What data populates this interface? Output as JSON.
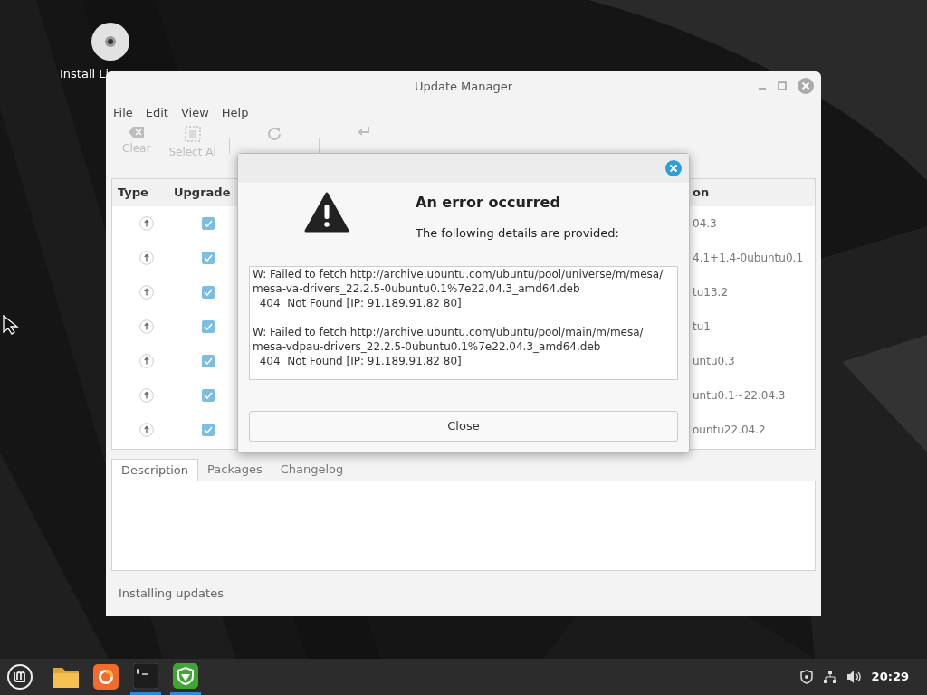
{
  "desktop": {
    "icons": [
      {
        "label": "Install Li"
      }
    ]
  },
  "window": {
    "title": "Update Manager",
    "menu": [
      "File",
      "Edit",
      "View",
      "Help"
    ],
    "toolbar": [
      {
        "kind": "clear",
        "label": "Clear",
        "disabled": true
      },
      {
        "kind": "select",
        "label": "Select Al",
        "disabled": true
      },
      {
        "kind": "refresh",
        "disabled": true
      },
      {
        "kind": "install",
        "disabled": true
      }
    ],
    "table": {
      "columns": [
        "Type",
        "Upgrade",
        "on"
      ],
      "rows": [
        {
          "upgrade": true,
          "version": "04.3"
        },
        {
          "upgrade": true,
          "version": "4.1+1.4-0ubuntu0.1"
        },
        {
          "upgrade": true,
          "version": "tu13.2"
        },
        {
          "upgrade": true,
          "version": "tu1"
        },
        {
          "upgrade": true,
          "version": "untu0.3"
        },
        {
          "upgrade": true,
          "version": "untu0.1~22.04.3"
        },
        {
          "upgrade": true,
          "version": "ountu22.04.2"
        }
      ]
    },
    "tabs": [
      {
        "label": "Description",
        "selected": true
      },
      {
        "label": "Packages",
        "selected": false
      },
      {
        "label": "Changelog",
        "selected": false
      }
    ],
    "status_bar": "Installing updates"
  },
  "dialog": {
    "title": "An error occurred",
    "subtitle": "The following details are provided:",
    "details": [
      [
        "W: Failed to fetch http://archive.ubuntu.com/ubuntu/pool/universe/m/mesa/",
        "mesa-va-drivers_22.2.5-0ubuntu0.1%7e22.04.3_amd64.deb",
        "  404  Not Found [IP: 91.189.91.82 80]"
      ],
      [
        "W: Failed to fetch http://archive.ubuntu.com/ubuntu/pool/main/m/mesa/",
        "mesa-vdpau-drivers_22.2.5-0ubuntu0.1%7e22.04.3_amd64.deb",
        "  404  Not Found [IP: 91.189.91.82 80]"
      ]
    ],
    "button": "Close"
  },
  "taskbar": {
    "apps": [
      {
        "kind": "files",
        "running": false
      },
      {
        "kind": "browser",
        "running": false
      },
      {
        "kind": "terminal",
        "running": true
      },
      {
        "kind": "shield",
        "running": true
      }
    ],
    "clock": "20:29"
  }
}
